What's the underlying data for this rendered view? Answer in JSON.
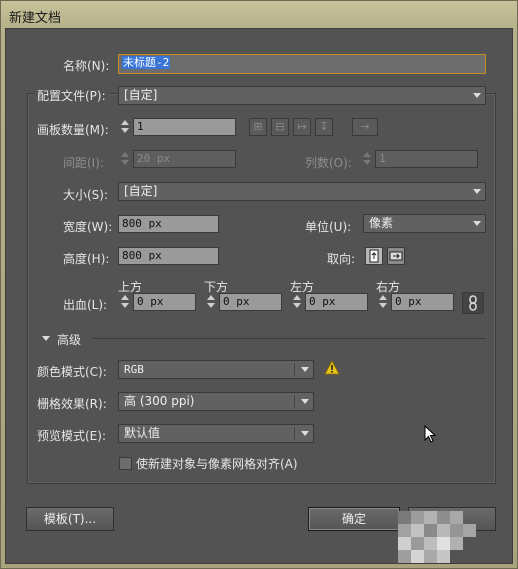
{
  "window": {
    "title": "新建文档"
  },
  "form": {
    "name_label": "名称(N):",
    "name_value": "未标题-2",
    "profile_label": "配置文件(P):",
    "profile_value": "[自定]",
    "artboards_label": "画板数量(M):",
    "artboards_value": "1",
    "spacing_label": "间距(I):",
    "spacing_value": "20 px",
    "columns_label": "列数(O):",
    "columns_value": "1",
    "size_label": "大小(S):",
    "size_value": "[自定]",
    "width_label": "宽度(W):",
    "width_value": "800 px",
    "units_label": "单位(U):",
    "units_value": "像素",
    "height_label": "高度(H):",
    "height_value": "800 px",
    "orientation_label": "取向:",
    "bleed_label": "出血(L):",
    "bleed": {
      "top_label": "上方",
      "top_value": "0 px",
      "bottom_label": "下方",
      "bottom_value": "0 px",
      "left_label": "左方",
      "left_value": "0 px",
      "right_label": "右方",
      "right_value": "0 px"
    }
  },
  "advanced": {
    "header": "高级",
    "color_mode_label": "颜色模式(C):",
    "color_mode_value": "RGB",
    "raster_label": "栅格效果(R):",
    "raster_value": "高 (300 ppi)",
    "preview_label": "预览模式(E):",
    "preview_value": "默认值",
    "align_pixel_label": "使新建对象与像素网格对齐(A)"
  },
  "footer": {
    "templates_label": "模板(T)...",
    "ok_label": "确定"
  },
  "colors": {
    "highlight": "#3875d7",
    "warning": "#e6c21c"
  },
  "icons": [
    "artboard-grid-by-row-icon",
    "artboard-grid-by-column-icon",
    "artboard-arrange-row-icon",
    "artboard-arrange-column-icon",
    "rtl-arrow-icon",
    "portrait-icon",
    "landscape-icon",
    "chain-link-icon",
    "warning-icon",
    "triangle-down-icon"
  ]
}
